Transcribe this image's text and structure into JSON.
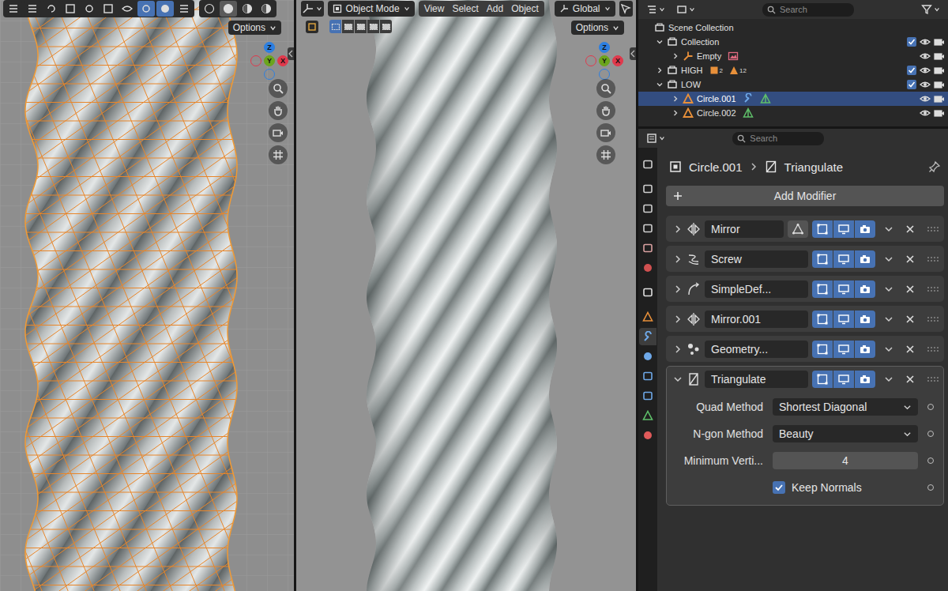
{
  "edit_viewport": {
    "options": "Options",
    "wireframe": true,
    "header_buttons": [
      {
        "kind": "editor",
        "on": false
      },
      {
        "kind": "pivot",
        "on": false
      },
      {
        "kind": "loop",
        "on": false
      },
      {
        "kind": "grid",
        "on": false
      },
      {
        "kind": "dot",
        "on": false
      },
      {
        "kind": "blank",
        "on": false
      },
      {
        "kind": "visibility",
        "on": false
      },
      {
        "kind": "gizmo",
        "on": true
      },
      {
        "kind": "overlay",
        "on": true
      },
      {
        "kind": "xray",
        "on": false
      }
    ],
    "shading": [
      {
        "kind": "wireframe",
        "selected": false
      },
      {
        "kind": "solid",
        "selected": true
      },
      {
        "kind": "material",
        "selected": false
      },
      {
        "kind": "rendered",
        "selected": false
      }
    ],
    "gizmo": [
      {
        "label": "Z",
        "color": "#2d7fe0",
        "kind": "positive"
      },
      {
        "label": "Y",
        "color": "#6ba51c",
        "kind": "positive"
      },
      {
        "label": "X",
        "color": "#e0394c",
        "kind": "positive"
      },
      {
        "label": "",
        "color": "#e0394c",
        "kind": "negative"
      },
      {
        "label": "",
        "color": "#2d7fe0",
        "kind": "negative"
      }
    ]
  },
  "object_viewport": {
    "mode_menu": "Object Mode",
    "menus": [
      "View",
      "Select",
      "Add",
      "Object"
    ],
    "orientation": "Global",
    "options": "Options",
    "select_modes": [
      {
        "selected": true
      },
      {
        "selected": false
      },
      {
        "selected": false
      },
      {
        "selected": false
      },
      {
        "selected": false
      }
    ],
    "gizmo": [
      {
        "label": "Z",
        "color": "#2d7fe0",
        "kind": "positive"
      },
      {
        "label": "Y",
        "color": "#6ba51c",
        "kind": "positive"
      },
      {
        "label": "X",
        "color": "#e0394c",
        "kind": "positive"
      },
      {
        "label": "",
        "color": "#e0394c",
        "kind": "negative"
      },
      {
        "label": "",
        "color": "#2d7fe0",
        "kind": "negative"
      }
    ]
  },
  "outliner": {
    "search": {
      "placeholder": "Search"
    },
    "scene": "Scene Collection",
    "collections": [
      {
        "label": "Collection",
        "expanded": true,
        "checked": true,
        "visible": true,
        "renderable": true,
        "counts": [],
        "objects": [
          {
            "label": "Empty",
            "kind": "empty",
            "selected": false,
            "visible": true,
            "renderable": true,
            "badges": [
              {
                "kind": "image"
              }
            ]
          }
        ]
      },
      {
        "label": "HIGH",
        "expanded": false,
        "checked": true,
        "visible": true,
        "renderable": true,
        "counts": [
          {
            "kind": "object",
            "count": "2"
          },
          {
            "kind": "mesh",
            "count": "12"
          }
        ],
        "objects": []
      },
      {
        "label": "LOW",
        "expanded": true,
        "checked": true,
        "visible": true,
        "renderable": true,
        "counts": [],
        "objects": [
          {
            "label": "Circle.001",
            "kind": "mesh",
            "selected": true,
            "visible": true,
            "renderable": true,
            "badges": [
              {
                "kind": "modifier"
              },
              {
                "kind": "mesh"
              }
            ]
          },
          {
            "label": "Circle.002",
            "kind": "mesh",
            "selected": false,
            "visible": true,
            "renderable": true,
            "badges": [
              {
                "kind": "mesh"
              }
            ]
          }
        ]
      }
    ]
  },
  "properties": {
    "search": {
      "placeholder": "Search"
    },
    "tabs": [
      {
        "kind": "tool",
        "selected": false
      },
      {
        "kind": "render",
        "selected": false
      },
      {
        "kind": "output",
        "selected": false
      },
      {
        "kind": "viewlayer",
        "selected": false
      },
      {
        "kind": "scene",
        "selected": false
      },
      {
        "kind": "world",
        "selected": false
      },
      {
        "kind": "collection",
        "selected": false
      },
      {
        "kind": "object",
        "selected": false
      },
      {
        "kind": "modifier",
        "selected": true
      },
      {
        "kind": "particles",
        "selected": false
      },
      {
        "kind": "physics",
        "selected": false
      },
      {
        "kind": "constraints",
        "selected": false
      },
      {
        "kind": "data",
        "selected": false
      },
      {
        "kind": "material",
        "selected": false
      }
    ],
    "breadcrumb": {
      "object": "Circle.001",
      "modifier": "Triangulate"
    },
    "add_modifier": "Add Modifier",
    "modifiers": [
      {
        "name": "Mirror",
        "kind": "mirror",
        "expanded": false,
        "active": false,
        "cage_button": true,
        "on_cage": false,
        "edit_mode": true,
        "viewport": true,
        "render": true,
        "fields": []
      },
      {
        "name": "Screw",
        "kind": "screw",
        "expanded": false,
        "active": false,
        "cage_button": false,
        "on_cage": false,
        "edit_mode": true,
        "viewport": true,
        "render": true,
        "fields": []
      },
      {
        "name": "SimpleDef...",
        "kind": "deform",
        "expanded": false,
        "active": false,
        "cage_button": false,
        "on_cage": false,
        "edit_mode": true,
        "viewport": true,
        "render": true,
        "fields": []
      },
      {
        "name": "Mirror.001",
        "kind": "mirror",
        "expanded": false,
        "active": false,
        "cage_button": false,
        "on_cage": false,
        "edit_mode": true,
        "viewport": true,
        "render": true,
        "fields": []
      },
      {
        "name": "Geometry...",
        "kind": "nodes",
        "expanded": false,
        "active": false,
        "cage_button": false,
        "on_cage": false,
        "edit_mode": true,
        "viewport": true,
        "render": true,
        "fields": []
      },
      {
        "name": "Triangulate",
        "kind": "triangulate",
        "expanded": true,
        "active": true,
        "cage_button": false,
        "on_cage": false,
        "edit_mode": true,
        "viewport": true,
        "render": true,
        "fields": [
          {
            "label": "Quad Method",
            "kind": "dropdown",
            "value": "Shortest Diagonal",
            "checked": false
          },
          {
            "label": "N-gon Method",
            "kind": "dropdown",
            "value": "Beauty",
            "checked": false
          },
          {
            "label": "Minimum Verti...",
            "kind": "number",
            "value": "4",
            "checked": false
          },
          {
            "label": "Keep Normals",
            "kind": "checkbox",
            "value": "",
            "checked": true
          }
        ]
      }
    ]
  }
}
